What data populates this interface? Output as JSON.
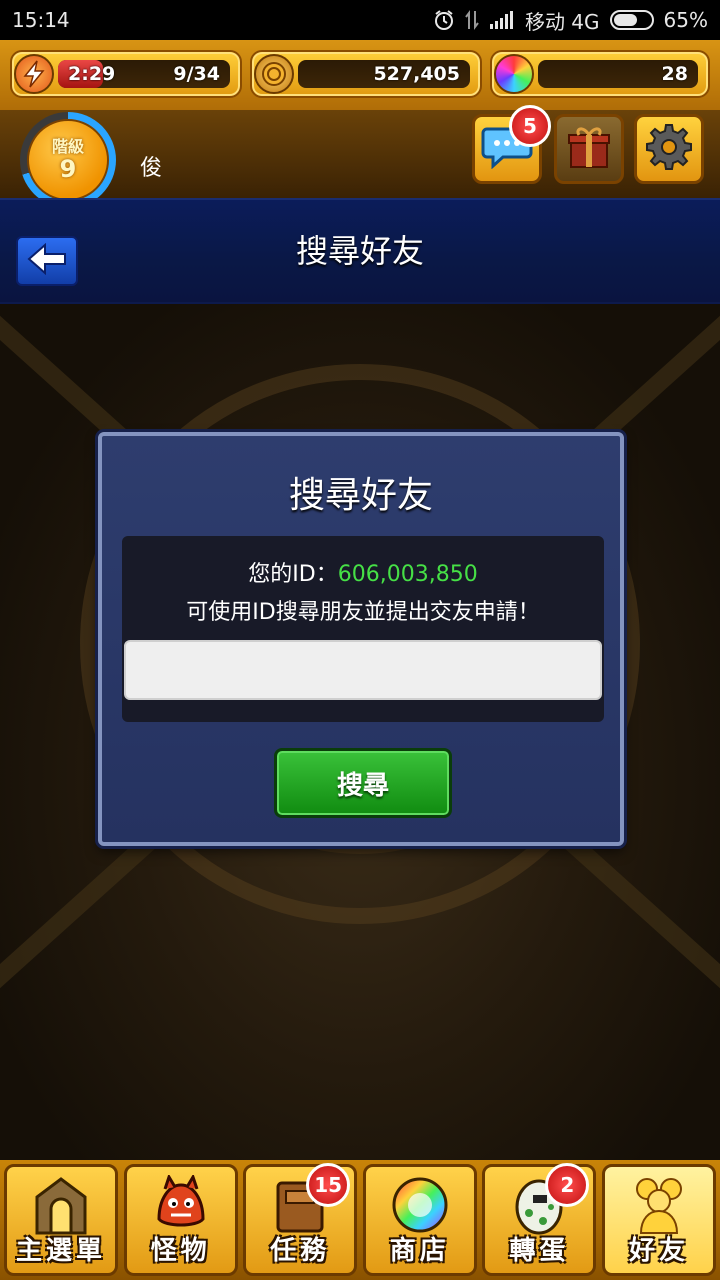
{
  "status_bar": {
    "time": "15:14",
    "carrier": "移动 4G",
    "battery": "65%",
    "battery_level": 0.65
  },
  "hud": {
    "stamina_timer": "2:29",
    "stamina": "9/34",
    "stamina_level": 0.26,
    "coins": "527,405",
    "orbs": "28"
  },
  "player": {
    "rank_label": "階級",
    "rank": "9",
    "rank_progress": 0.7,
    "name": "俊"
  },
  "top_buttons": {
    "chat_badge": "5"
  },
  "header": {
    "title": "搜尋好友"
  },
  "dialog": {
    "title": "搜尋好友",
    "id_label": "您的ID：",
    "id_value": "606,003,850",
    "hint": "可使用ID搜尋朋友並提出交友申請！",
    "input_value": "",
    "search_button": "搜尋"
  },
  "bottom_nav": {
    "items": [
      {
        "label": "主選單",
        "icon": "gate-icon"
      },
      {
        "label": "怪物",
        "icon": "monster-icon"
      },
      {
        "label": "任務",
        "icon": "book-icon",
        "badge": "15"
      },
      {
        "label": "商店",
        "icon": "orb-icon"
      },
      {
        "label": "轉蛋",
        "icon": "egg-icon",
        "badge": "2"
      },
      {
        "label": "好友",
        "icon": "friends-icon"
      }
    ],
    "active": "好友"
  },
  "colors": {
    "accent_gold": "#e29a14",
    "header_blue": "#0b1c5a",
    "dialog_blue": "#2e3d6e",
    "id_green": "#46e046",
    "button_green": "#108b10",
    "badge_red": "#c01010"
  }
}
